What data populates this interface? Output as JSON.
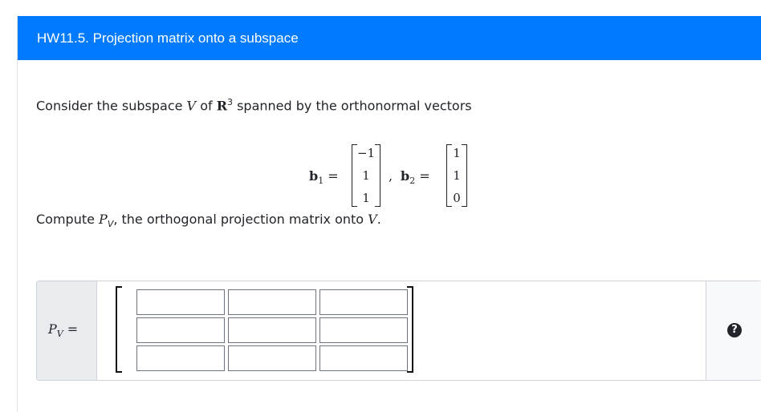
{
  "header": {
    "title": "HW11.5. Projection matrix onto a subspace"
  },
  "prompt": {
    "part1": "Consider the subspace ",
    "V": "V",
    "part2": " of ",
    "R": "R",
    "R_exp": "3",
    "part3": " spanned by the orthonormal vectors"
  },
  "vectors": {
    "b1_label": "b",
    "b1_sub": "1",
    "b1_entries": [
      "−1",
      "1",
      "1"
    ],
    "sep": ",",
    "b2_label": "b",
    "b2_sub": "2",
    "b2_entries": [
      "1",
      "1",
      "0"
    ],
    "equals": "="
  },
  "compute": {
    "part1": "Compute ",
    "P": "P",
    "P_sub": "V",
    "part2": ", the orthogonal projection matrix onto ",
    "V": "V",
    "period": "."
  },
  "answer": {
    "label_P": "P",
    "label_sub": "V",
    "label_eq": " =",
    "cells": [
      [
        "",
        "",
        ""
      ],
      [
        "",
        "",
        ""
      ],
      [
        "",
        "",
        ""
      ]
    ],
    "help_icon": "question-circle",
    "help_glyph": "?"
  }
}
